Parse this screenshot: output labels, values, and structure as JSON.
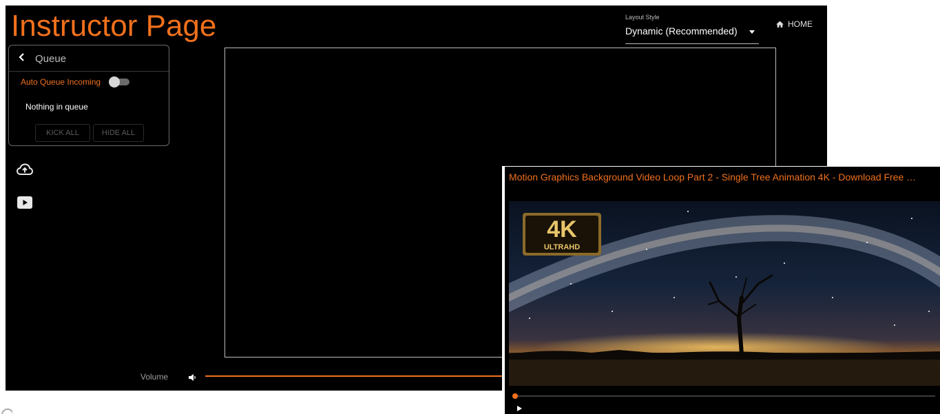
{
  "header": {
    "title": "Instructor Page",
    "layout_label": "Layout Style",
    "layout_value": "Dynamic (Recommended)",
    "home_label": "HOME"
  },
  "queue": {
    "title": "Queue",
    "auto_queue_label": "Auto Queue Incoming",
    "auto_queue_on": false,
    "empty_text": "Nothing in queue",
    "kick_all_label": "KICK ALL",
    "hide_all_label": "HIDE ALL"
  },
  "sidebar_icons": [
    "cloud-upload-icon",
    "youtube-icon"
  ],
  "volume": {
    "label": "Volume",
    "level": 1.0
  },
  "video": {
    "title": "Motion Graphics Background Video Loop Part 2 - Single Tree Animation 4K - Download Free …",
    "badge_main": "4K",
    "badge_sub": "ULTRAHD",
    "progress": 0.0
  },
  "colors": {
    "accent": "#f0701c",
    "background": "#000000",
    "panel_border": "#6a6a6a"
  }
}
